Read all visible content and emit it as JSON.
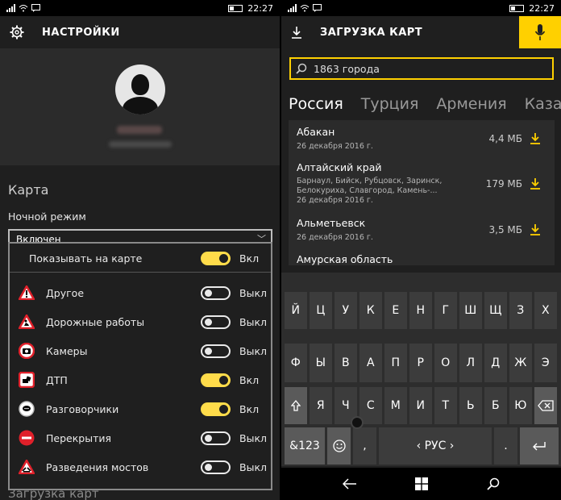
{
  "status": {
    "time": "22:27"
  },
  "left": {
    "title": "НАСТРОЙКИ",
    "section": "Карта",
    "night_mode_label": "Ночной режим",
    "night_mode_value": "Включен",
    "hidden_section": "Загрузка карт",
    "popup": {
      "header": {
        "label": "Показывать на карте",
        "state": "Вкл",
        "on": true
      },
      "items": [
        {
          "label": "Другое",
          "state": "Выкл",
          "on": false,
          "icon": "warning-icon"
        },
        {
          "label": "Дорожные работы",
          "state": "Выкл",
          "on": false,
          "icon": "road-works-icon"
        },
        {
          "label": "Камеры",
          "state": "Выкл",
          "on": false,
          "icon": "camera-icon"
        },
        {
          "label": "ДТП",
          "state": "Вкл",
          "on": true,
          "icon": "accident-icon"
        },
        {
          "label": "Разговорчики",
          "state": "Вкл",
          "on": true,
          "icon": "chat-icon"
        },
        {
          "label": "Перекрытия",
          "state": "Выкл",
          "on": false,
          "icon": "no-entry-icon"
        },
        {
          "label": "Разведения мостов",
          "state": "Выкл",
          "on": false,
          "icon": "bridge-icon"
        }
      ]
    },
    "colors": {
      "accent": "#ffdc4a",
      "red": "#e0202a"
    }
  },
  "right": {
    "title": "ЗАГРУЗКА КАРТ",
    "search_placeholder": "1863 города",
    "tabs": [
      "Россия",
      "Турция",
      "Армения",
      "Казахстан"
    ],
    "cities": [
      {
        "name": "Абакан",
        "sub": "26 декабря 2016 г.",
        "size": "4,4 МБ"
      },
      {
        "name": "Алтайский край",
        "sub": "Барнаул, Бийск, Рубцовск, Заринск,\nБелокуриха, Славгород, Камень-...\n26 декабря 2016 г.",
        "size": "179 МБ"
      },
      {
        "name": "Альметьевск",
        "sub": "26 декабря 2016 г.",
        "size": "3,5 МБ"
      },
      {
        "name": "Амурская область",
        "sub": "",
        "size": ""
      }
    ],
    "keyboard": {
      "row1": [
        "Й",
        "Ц",
        "У",
        "К",
        "Е",
        "Н",
        "Г",
        "Ш",
        "Щ",
        "З",
        "Х"
      ],
      "row2": [
        "Ф",
        "Ы",
        "В",
        "А",
        "П",
        "Р",
        "О",
        "Л",
        "Д",
        "Ж",
        "Э"
      ],
      "row3": [
        "Я",
        "Ч",
        "С",
        "М",
        "И",
        "Т",
        "Ь",
        "Б",
        "Ю"
      ],
      "symbols": "&123",
      "comma": ",",
      "space": "‹ РУС ›",
      "period": "."
    },
    "colors": {
      "accent": "#ffd000"
    }
  }
}
